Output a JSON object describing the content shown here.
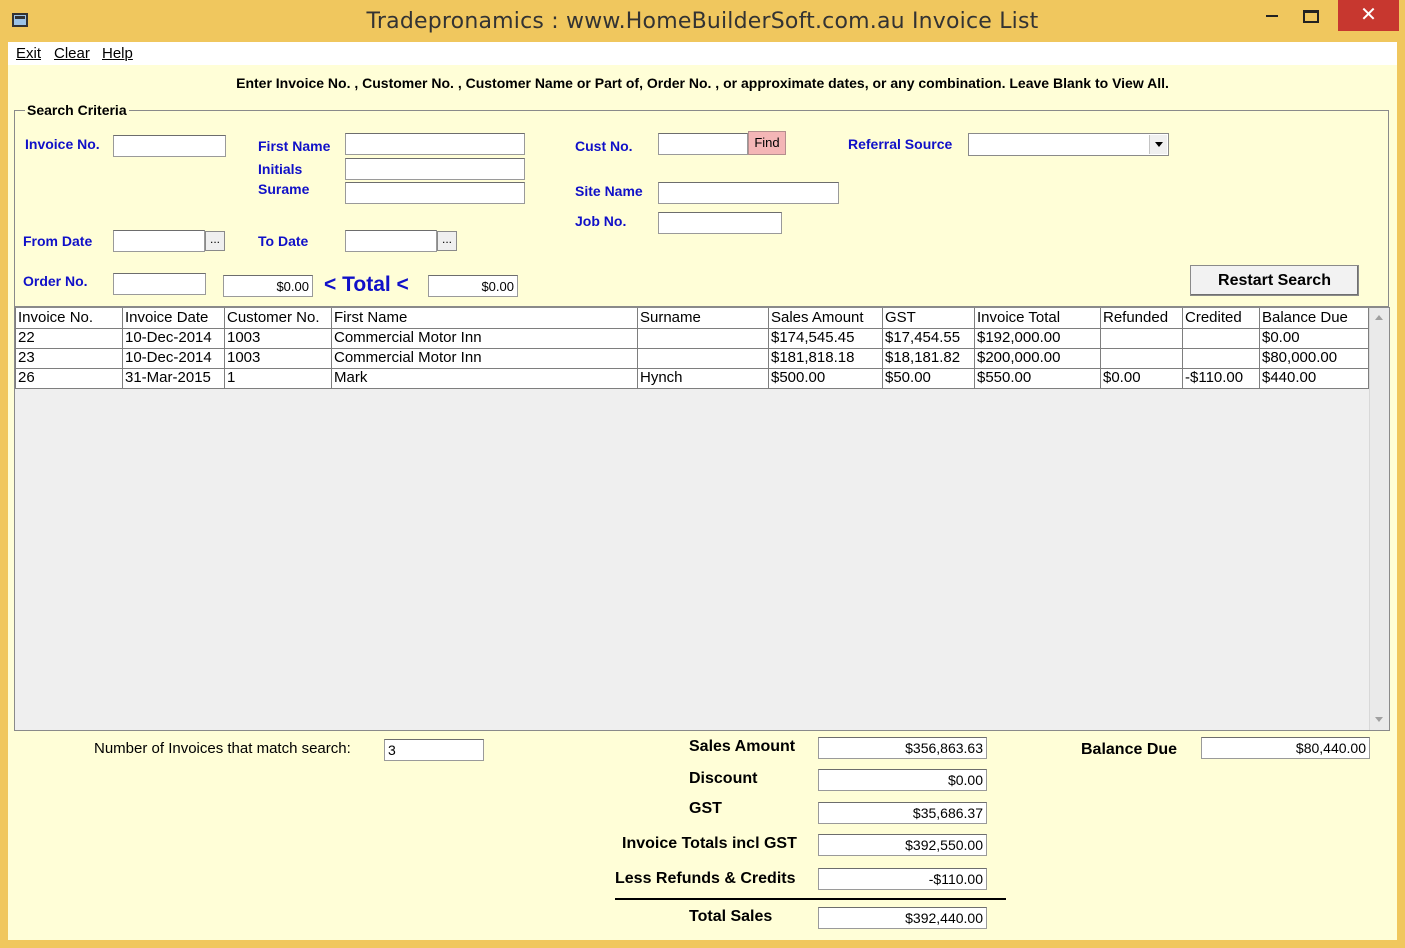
{
  "window": {
    "title": "Tradepronamics :   www.HomeBuilderSoft.com.au     Invoice List",
    "min_label": "",
    "max_label": "",
    "close_label": "✕"
  },
  "menu": [
    "Exit",
    "Clear",
    "Help"
  ],
  "instructions": "Enter Invoice No. , Customer No. , Customer Name or Part of, Order No. , or approximate dates, or any combination. Leave Blank to View All.",
  "search": {
    "legend": "Search Criteria",
    "invoice_no_label": "Invoice No.",
    "first_name_label": "First Name",
    "initials_label": "Initials",
    "surname_label": "Surame",
    "cust_no_label": "Cust No.",
    "find_label": "Find",
    "referral_source_label": "Referral Source",
    "site_name_label": "Site Name",
    "job_no_label": "Job No.",
    "from_date_label": "From Date",
    "to_date_label": "To Date",
    "date_button_label": "...",
    "order_no_label": "Order No.",
    "total_label": "< Total <",
    "total_left_value": "$0.00",
    "total_right_value": "$0.00",
    "restart_label": "Restart Search",
    "invoice_no_value": "",
    "first_name_value": "",
    "initials_value": "",
    "surname_value": "",
    "cust_no_value": "",
    "referral_source_value": "",
    "site_name_value": "",
    "job_no_value": "",
    "from_date_value": "",
    "to_date_value": "",
    "order_no_value": ""
  },
  "grid": {
    "columns": [
      "Invoice No.",
      "Invoice Date",
      "Customer No.",
      "First Name",
      "Surname",
      "Sales Amount",
      "GST",
      "Invoice Total",
      "Refunded",
      "Credited",
      "Balance Due"
    ],
    "rows": [
      [
        "22",
        "10-Dec-2014",
        "1003",
        "Commercial Motor Inn",
        "",
        "$174,545.45",
        "$17,454.55",
        "$192,000.00",
        "",
        "",
        "$0.00"
      ],
      [
        "23",
        "10-Dec-2014",
        "1003",
        "Commercial Motor Inn",
        "",
        "$181,818.18",
        "$18,181.82",
        "$200,000.00",
        "",
        "",
        "$80,000.00"
      ],
      [
        "26",
        "31-Mar-2015",
        "1",
        "Mark",
        "Hynch",
        "$500.00",
        "$50.00",
        "$550.00",
        "$0.00",
        "-$110.00",
        "$440.00"
      ]
    ]
  },
  "summary": {
    "match_count_label": "Number of Invoices that match search:",
    "match_count": "3",
    "sales_amount_label": "Sales Amount",
    "sales_amount": "$356,863.63",
    "discount_label": "Discount",
    "discount": "$0.00",
    "gst_label": "GST",
    "gst": "$35,686.37",
    "invoice_totals_label": "Invoice Totals incl GST",
    "invoice_totals": "$392,550.00",
    "less_refunds_label": "Less Refunds & Credits",
    "less_refunds": "-$110.00",
    "total_sales_label": "Total Sales",
    "total_sales": "$392,440.00",
    "balance_due_label": "Balance Due",
    "balance_due": "$80,440.00"
  },
  "colors": {
    "window_frame": "#f0c75e",
    "form_background": "#fffed7",
    "label_blue": "#1010c8",
    "find_button": "#f4b6b6",
    "close_button": "#c7372f"
  }
}
